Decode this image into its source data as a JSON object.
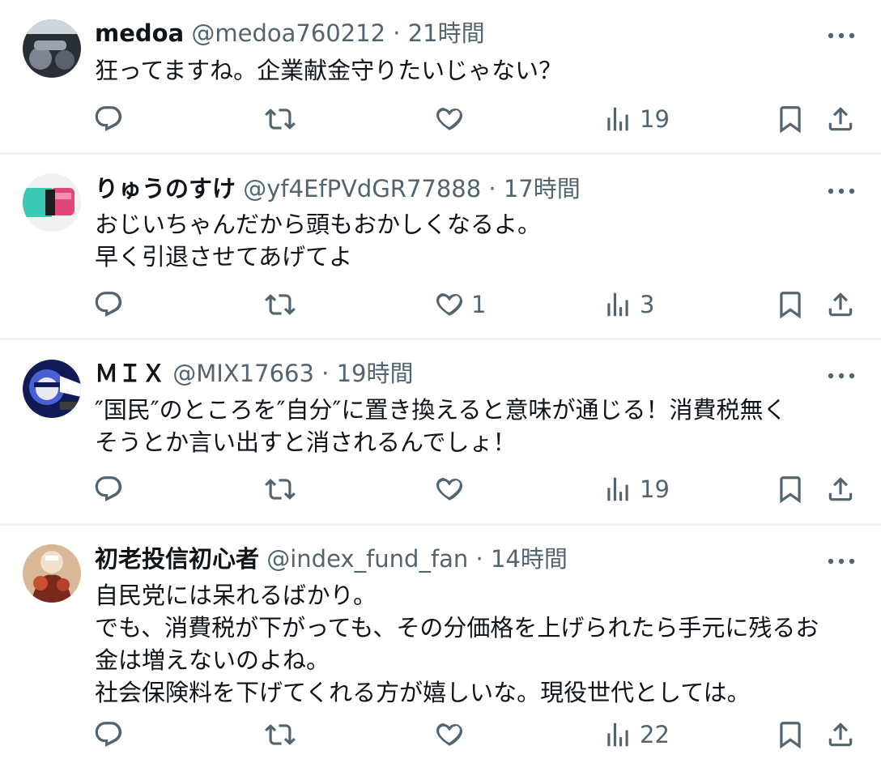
{
  "tweets": [
    {
      "name": "medoa",
      "handle": "@medoa760212",
      "sep": "·",
      "time": "21時間",
      "lines": [
        "狂ってますね。企業献金守りたいじゃない？"
      ],
      "likes": "",
      "views": "19",
      "avatar_colors": [
        "#2a2f36",
        "#7d8590"
      ]
    },
    {
      "name": "りゅうのすけ",
      "handle": "@yf4EfPVdGR77888",
      "sep": "·",
      "time": "17時間",
      "lines": [
        "おじいちゃんだから頭もおかしくなるよ。",
        "早く引退させてあげてよ"
      ],
      "likes": "1",
      "views": "3",
      "avatar_colors": [
        "#3cc9b5",
        "#e0487a"
      ]
    },
    {
      "name": "ＭＩＸ",
      "handle": "@MIX17663",
      "sep": "·",
      "time": "19時間",
      "lines": [
        "″国民″のところを″自分″に置き換えると意味が通じる！消費税無く",
        "そうとか言い出すと消されるんでしょ！"
      ],
      "likes": "",
      "views": "19",
      "avatar_colors": [
        "#101a55",
        "#4a5fd6"
      ]
    },
    {
      "name": "初老投信初心者",
      "handle": "@index_fund_fan",
      "sep": "·",
      "time": "14時間",
      "lines": [
        "自民党には呆れるばかり。",
        "でも、消費税が下がっても、その分価格を上げられたら手元に残るお",
        "金は増えないのよね。",
        "社会保険料を下げてくれる方が嬉しいな。現役世代としては。"
      ],
      "likes": "",
      "views": "22",
      "avatar_colors": [
        "#7a2a1c",
        "#d9b89a"
      ]
    }
  ],
  "icons": {
    "reply": "reply-icon",
    "retweet": "retweet-icon",
    "like": "heart-icon",
    "views": "views-icon",
    "bookmark": "bookmark-icon",
    "share": "share-icon",
    "more": "more-icon"
  },
  "colors": {
    "text": "#0f1419",
    "secondary": "#536471",
    "divider": "#eff3f4"
  }
}
